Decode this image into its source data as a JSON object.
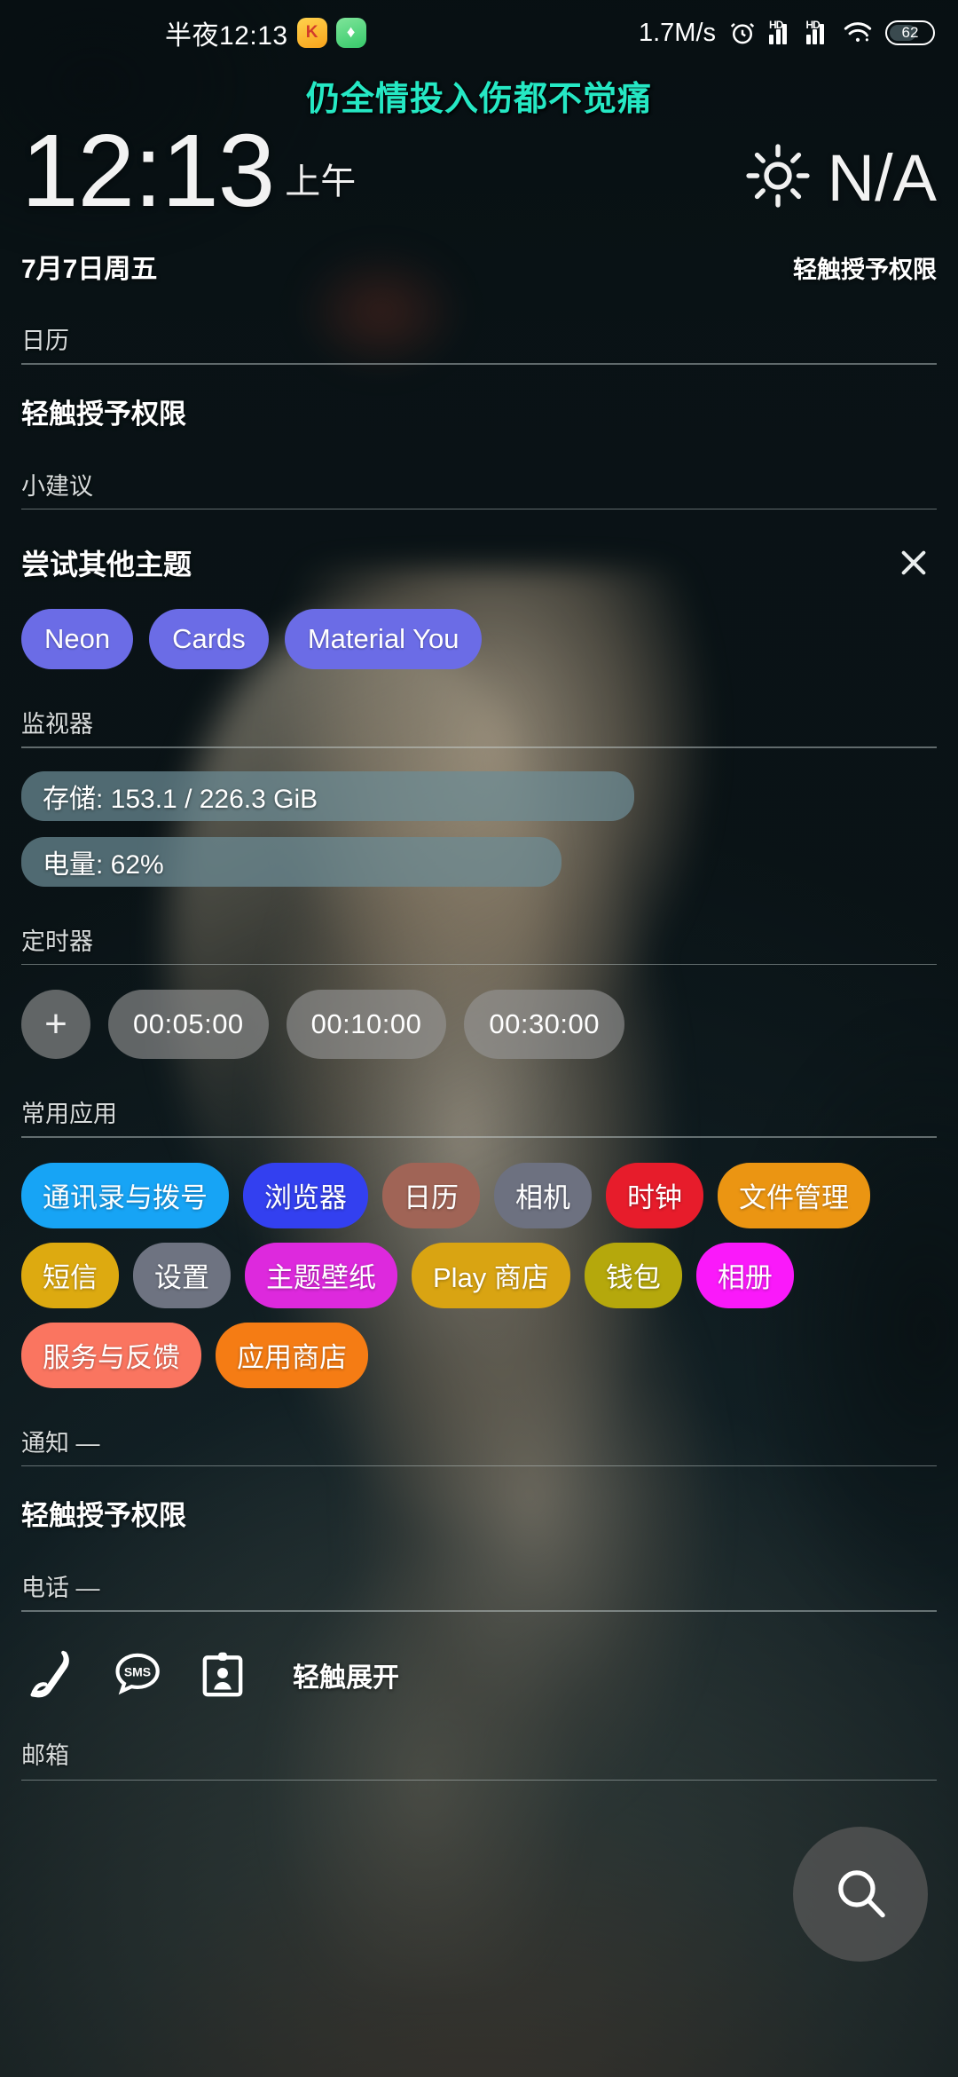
{
  "status_bar": {
    "clock": "半夜12:13",
    "badges": [
      {
        "name": "music-app-badge",
        "glyph": "K"
      },
      {
        "name": "security-app-badge",
        "glyph": "♦"
      }
    ],
    "network_speed": "1.7M/s",
    "alarm_icon": "alarm-icon",
    "signal_labels": [
      "HD",
      "HD"
    ],
    "wifi_icon": "wifi-icon",
    "battery_level": "62"
  },
  "lyrics_overlay": "仍全情投入伤都不觉痛",
  "clock": {
    "time": "12:13",
    "meridiem": "上午",
    "weather_icon": "sun-icon",
    "weather_temp": "N/A"
  },
  "date_row": {
    "date": "7月7日周五",
    "permission_hint": "轻触授予权限"
  },
  "calendar": {
    "section_title": "日历",
    "body": "轻触授予权限"
  },
  "suggestions": {
    "section_title": "小建议",
    "title": "尝试其他主题",
    "close_icon": "close-icon",
    "themes": [
      "Neon",
      "Cards",
      "Material You"
    ],
    "chip_color": "#6b6ce6"
  },
  "monitor": {
    "section_title": "监视器",
    "items": [
      {
        "label": "存储: 153.1 / 226.3 GiB",
        "percent": 67
      },
      {
        "label": "电量: 62%",
        "percent": 59
      }
    ]
  },
  "timers": {
    "section_title": "定时器",
    "add_label": "+",
    "presets": [
      "00:05:00",
      "00:10:00",
      "00:30:00"
    ]
  },
  "apps": {
    "section_title": "常用应用",
    "items": [
      {
        "label": "通讯录与拨号",
        "color": "#17a4f5"
      },
      {
        "label": "浏览器",
        "color": "#3340f0"
      },
      {
        "label": "日历",
        "color": "#a06456"
      },
      {
        "label": "相机",
        "color": "#6d7180"
      },
      {
        "label": "时钟",
        "color": "#e71c2b"
      },
      {
        "label": "文件管理",
        "color": "#eb9512"
      },
      {
        "label": "短信",
        "color": "#ddaa10"
      },
      {
        "label": "设置",
        "color": "#6e7381"
      },
      {
        "label": "主题壁纸",
        "color": "#dd29dd"
      },
      {
        "label": "Play 商店",
        "color": "#d9a412"
      },
      {
        "label": "钱包",
        "color": "#b5a80c"
      },
      {
        "label": "相册",
        "color": "#fa19fa"
      },
      {
        "label": "服务与反馈",
        "color": "#fa7560"
      },
      {
        "label": "应用商店",
        "color": "#f57c14"
      }
    ]
  },
  "notifications": {
    "section_title": "通知 —",
    "body": "轻触授予权限"
  },
  "phone": {
    "section_title": "电话 —",
    "icons": [
      "phone-icon",
      "sms-icon",
      "contact-card-icon"
    ],
    "expand_hint": "轻触展开"
  },
  "search_fab": {
    "icon": "search-icon"
  },
  "mail": {
    "section_title": "邮箱"
  }
}
